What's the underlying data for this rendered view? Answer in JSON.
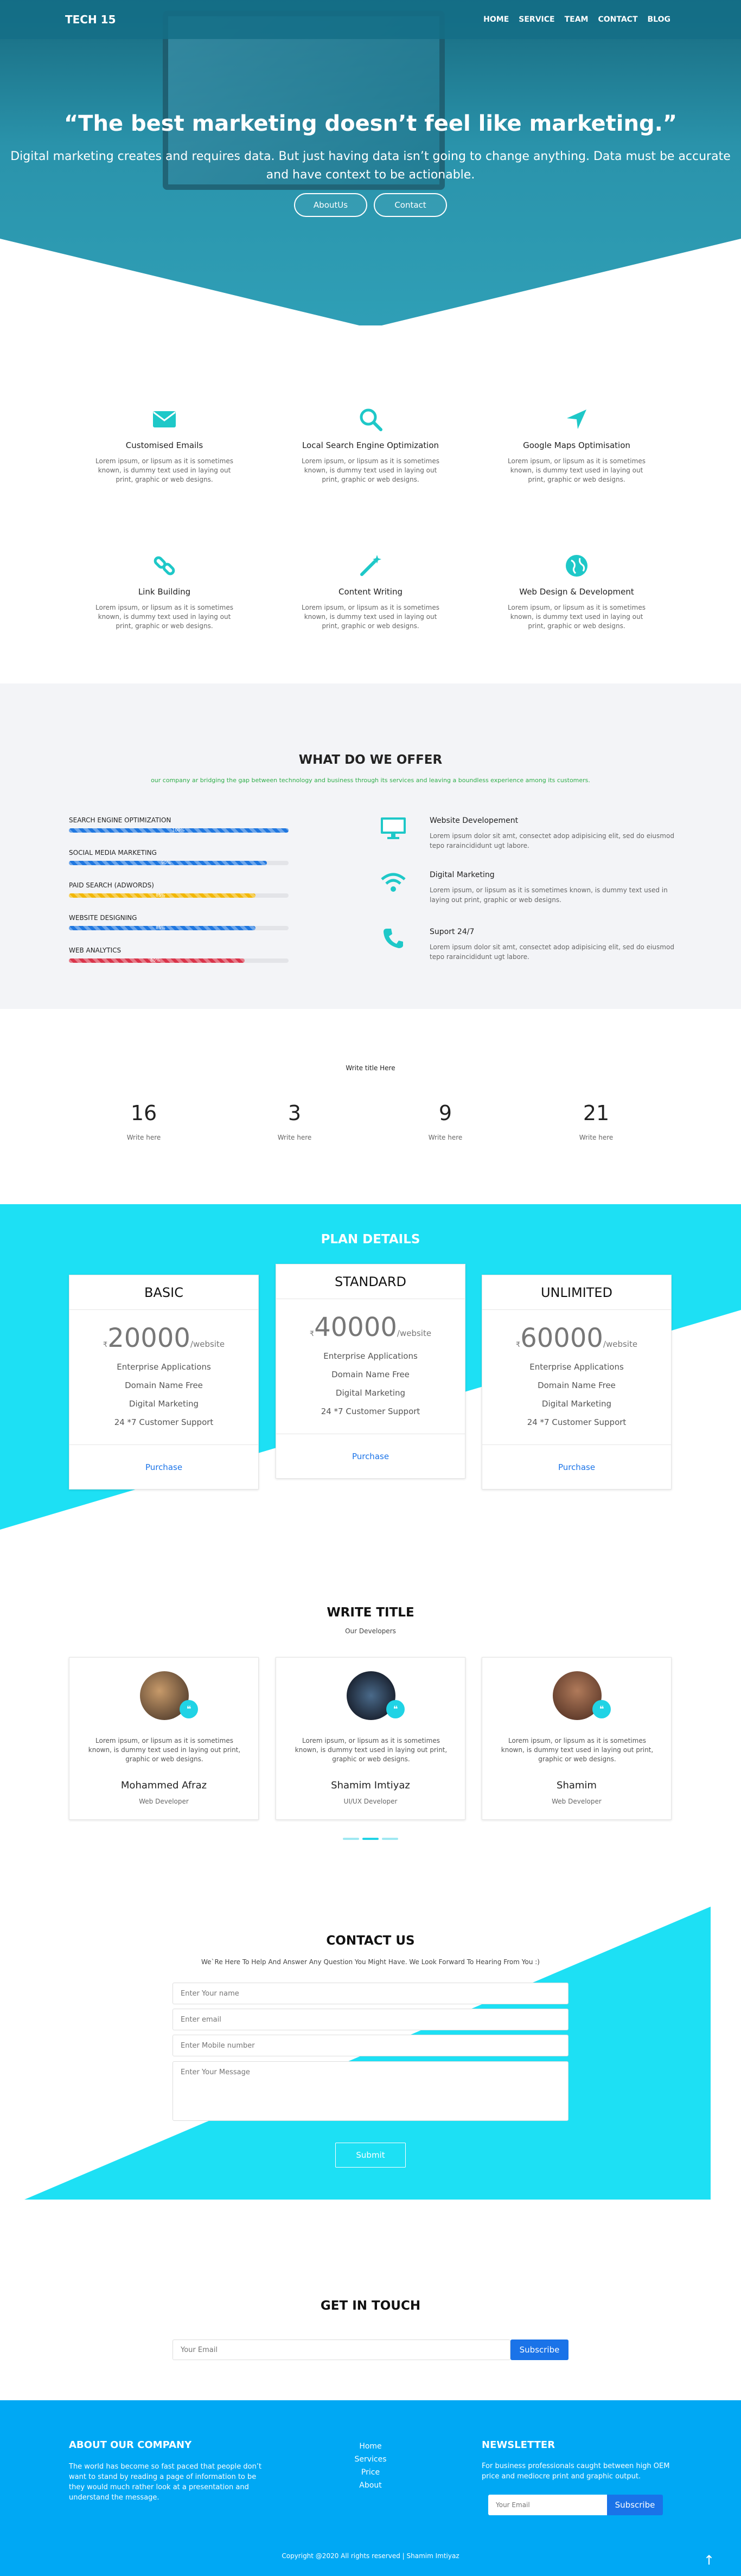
{
  "nav": {
    "brand": "TECH 15",
    "items": [
      "HOME",
      "SERVICE",
      "TEAM",
      "CONTACT",
      "BLOG"
    ]
  },
  "hero": {
    "title": "“The best marketing doesn’t feel like marketing.”",
    "text": "Digital marketing creates and requires data. But just having data isn’t going to change anything. Data must be accurate and have context to be actionable.",
    "buttons": [
      "AboutUs",
      "Contact"
    ]
  },
  "services": [
    {
      "icon": "envelope-icon",
      "title": "Customised Emails",
      "text": "Lorem ipsum, or lipsum as it is sometimes known, is dummy text used in laying out print, graphic or web designs."
    },
    {
      "icon": "search-icon",
      "title": "Local Search Engine Optimization",
      "text": "Lorem ipsum, or lipsum as it is sometimes known, is dummy text used in laying out print, graphic or web designs."
    },
    {
      "icon": "location-arrow-icon",
      "title": "Google Maps Optimisation",
      "text": "Lorem ipsum, or lipsum as it is sometimes known, is dummy text used in laying out print, graphic or web designs."
    },
    {
      "icon": "link-icon",
      "title": "Link Building",
      "text": "Lorem ipsum, or lipsum as it is sometimes known, is dummy text used in laying out print, graphic or web designs."
    },
    {
      "icon": "magic-wand-icon",
      "title": "Content Writing",
      "text": "Lorem ipsum, or lipsum as it is sometimes known, is dummy text used in laying out print, graphic or web designs."
    },
    {
      "icon": "globe-icon",
      "title": "Web Design & Development",
      "text": "Lorem ipsum, or lipsum as it is sometimes known, is dummy text used in laying out print, graphic or web designs."
    }
  ],
  "offer": {
    "title": "WHAT DO WE OFFER",
    "subtitle": "our company ar bridging the gap between technology and business through its services and leaving a boundless experience among its customers.",
    "skills": [
      {
        "label": "SEARCH ENGINE OPTIMIZATION",
        "pct_text": "100%",
        "value": 100,
        "color": "#1f77e0"
      },
      {
        "label": "SOCIAL MEDIA MARKETING",
        "pct_text": "90%",
        "value": 90,
        "color": "#1f77e0"
      },
      {
        "label": "PAID SEARCH (ADWORDS)",
        "pct_text": "85%",
        "value": 85,
        "color": "#f2b705"
      },
      {
        "label": "WEBSITE DESIGNING",
        "pct_text": "85%",
        "value": 85,
        "color": "#1f77e0"
      },
      {
        "label": "WEB ANALYTICS",
        "pct_text": "80%",
        "value": 80,
        "color": "#d9344a"
      }
    ],
    "features": [
      {
        "icon": "monitor-icon",
        "title": "Website Developement",
        "text": "Lorem ipsum dolor sit amt, consectet adop adipisicing elit, sed do eiusmod tepo raraincididunt ugt labore."
      },
      {
        "icon": "wifi-icon",
        "title": "Digital Marketing",
        "text": "Lorem ipsum, or lipsum as it is sometimes known, is dummy text used in laying out print, graphic or web designs."
      },
      {
        "icon": "phone-icon",
        "title": "Suport 24/7",
        "text": "Lorem ipsum dolor sit amt, consectet adop adipisicing elit, sed do eiusmod tepo raraincididunt ugt labore."
      }
    ]
  },
  "counter": {
    "title": "Write title Here",
    "items": [
      {
        "n": "16",
        "l": "Write here"
      },
      {
        "n": "3",
        "l": "Write here"
      },
      {
        "n": "9",
        "l": "Write here"
      },
      {
        "n": "21",
        "l": "Write here"
      }
    ]
  },
  "pricing": {
    "title": "PLAN DETAILS",
    "plans": [
      {
        "name": "BASIC",
        "currency": "₹",
        "amount": "20000",
        "per": "/website",
        "features": [
          "Enterprise Applications",
          "Domain Name Free",
          "Digital Marketing",
          "24 *7 Customer Support"
        ],
        "cta": "Purchase"
      },
      {
        "name": "STANDARD",
        "currency": "₹",
        "amount": "40000",
        "per": "/website",
        "features": [
          "Enterprise Applications",
          "Domain Name Free",
          "Digital Marketing",
          "24 *7 Customer Support"
        ],
        "cta": "Purchase"
      },
      {
        "name": "UNLIMITED",
        "currency": "₹",
        "amount": "60000",
        "per": "/website",
        "features": [
          "Enterprise Applications",
          "Domain Name Free",
          "Digital Marketing",
          "24 *7 Customer Support"
        ],
        "cta": "Purchase"
      }
    ]
  },
  "team": {
    "title": "WRITE TITLE",
    "subtitle": "Our Developers",
    "members": [
      {
        "name": "Mohammed Afraz",
        "role": "Web Developer",
        "text": "Lorem ipsum, or lipsum as it is sometimes known, is dummy text used in laying out print, graphic or web designs."
      },
      {
        "name": "Shamim Imtiyaz",
        "role": "UI/UX Developer",
        "text": "Lorem ipsum, or lipsum as it is sometimes known, is dummy text used in laying out print, graphic or web designs."
      },
      {
        "name": "Shamim",
        "role": "Web Developer",
        "text": "Lorem ipsum, or lipsum as it is sometimes known, is dummy text used in laying out print, graphic or web designs."
      }
    ]
  },
  "contact": {
    "title": "CONTACT US",
    "subtitle": "We`Re Here To Help And Answer Any Question You Might Have. We Look Forward To Hearing From You :)",
    "name_ph": "Enter Your name",
    "email_ph": "Enter email",
    "mobile_ph": "Enter Mobile number",
    "msg_ph": "Enter Your Message",
    "submit": "Submit"
  },
  "touch": {
    "title": "GET IN TOUCH",
    "email_ph": "Your Email",
    "button": "Subscribe"
  },
  "footer": {
    "about_title": "ABOUT OUR COMPANY",
    "about_text": "The world has become so fast paced that people don’t want to stand by reading a page of information to be they would much rather look at a presentation and understand the message.",
    "links": [
      "Home",
      "Services",
      "Price",
      "About"
    ],
    "newsletter_title": "NEWSLETTER",
    "newsletter_text": "For business professionals caught between high OEM price and mediocre print and graphic output.",
    "newsletter_ph": "Your Email",
    "newsletter_button": "Subscribe",
    "copyright": "Copyright @2020 All rights reserved | Shamim Imtiyaz",
    "to_top_icon": "arrow-up-icon"
  },
  "colors": {
    "accent": "#1de0f4",
    "primary": "#1a73e8",
    "footer": "#00a8f4"
  }
}
